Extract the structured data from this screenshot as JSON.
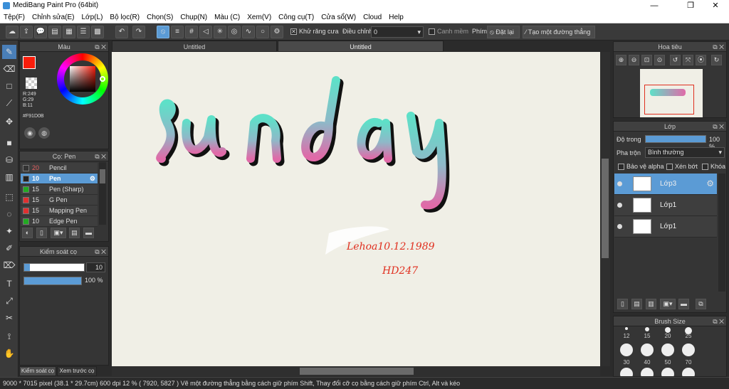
{
  "app": {
    "title": "MediBang Paint Pro (64bit)"
  },
  "window": {
    "minimize": "—",
    "maximize": "❐",
    "close": "✕"
  },
  "menu": [
    "Tệp(F)",
    "Chỉnh sửa(E)",
    "Lớp(L)",
    "Bộ lọc(R)",
    "Chọn(S)",
    "Chụp(N)",
    "Màu (C)",
    "Xem(V)",
    "Công cụ(T)",
    "Cửa sổ(W)",
    "Cloud",
    "Help"
  ],
  "toolbar": {
    "antialias_label": "Khử răng cưa",
    "adjust_label": "Điều chỉnh",
    "adjust_value": "0",
    "snap_label": "Canh mềm",
    "phim_label": "Phím",
    "off_label": "Đặt lại",
    "straight_label": "Tạo một đường thẳng"
  },
  "tabs": [
    {
      "label": "Untitled"
    },
    {
      "label": "Untitled"
    }
  ],
  "color_panel": {
    "title": "Màu",
    "r": "R:249",
    "g": "G:29",
    "b": "B:11",
    "hex": "#F91D0B",
    "fg": "#f91d0b"
  },
  "brush_panel": {
    "title": "Cọ: Pen",
    "items": [
      {
        "size": "20",
        "name": "Pencil",
        "color": "#333333",
        "sizecolor": "#e06060"
      },
      {
        "size": "10",
        "name": "Pen",
        "color": "#222222",
        "sizecolor": "#ffffff"
      },
      {
        "size": "15",
        "name": "Pen (Sharp)",
        "color": "#22aa22",
        "sizecolor": "#dddddd"
      },
      {
        "size": "15",
        "name": "G Pen",
        "color": "#e03030",
        "sizecolor": "#dddddd"
      },
      {
        "size": "15",
        "name": "Mapping Pen",
        "color": "#e03030",
        "sizecolor": "#dddddd"
      },
      {
        "size": "10",
        "name": "Edge Pen",
        "color": "#22aa22",
        "sizecolor": "#dddddd"
      }
    ]
  },
  "brush_control": {
    "title": "Kiểm soát cọ",
    "size_value": "10",
    "opacity_value": "100 %",
    "size_fraction": 0.1,
    "opacity_fraction": 1.0
  },
  "bottom_tabs": [
    "Kiểm soát cọ",
    "Xem trước cọ"
  ],
  "navigator": {
    "title": "Hoa tiêu"
  },
  "layer_panel": {
    "title": "Lớp",
    "opacity_label": "Độ trong",
    "opacity_value": "100 %",
    "blend_label": "Pha trộn",
    "blend_value": "Bình thường",
    "protect_alpha": "Bảo vệ alpha",
    "clipping": "Xén bớt",
    "lock": "Khóa",
    "layers": [
      {
        "name": "Lớp3",
        "selected": true
      },
      {
        "name": "Lớp1",
        "selected": false
      },
      {
        "name": "Lớp1",
        "selected": false
      }
    ]
  },
  "brush_size": {
    "title": "Brush Size",
    "row1": [
      "12",
      "15",
      "20",
      "25"
    ],
    "row2": [
      "30",
      "40",
      "50",
      "70"
    ]
  },
  "canvas": {
    "signature_line1": "Lehoa10.12.1989",
    "signature_line2": "HD247"
  },
  "status": {
    "text": "9000 * 7015 pixel   (38.1 * 29.7cm)   600 dpi   12 %   ( 7920, 5827 )   Vẽ một đường thẳng bằng cách giữ phím Shift, Thay đổi cỡ cọ bằng cách giữ phím Ctrl, Alt và kéo"
  }
}
